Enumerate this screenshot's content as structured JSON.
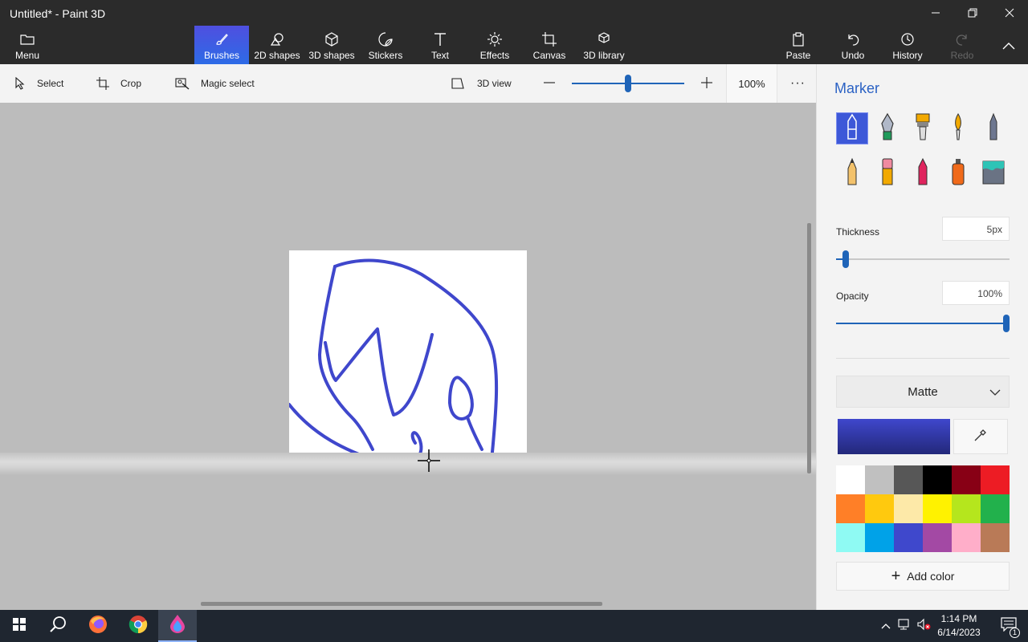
{
  "window": {
    "title": "Untitled* - Paint 3D",
    "minimize_icon": "minimize-icon",
    "restore_icon": "restore-icon",
    "close_icon": "close-icon"
  },
  "ribbon": {
    "menu_label": "Menu",
    "tabs": [
      {
        "label": "Brushes",
        "icon": "brush-icon",
        "active": true
      },
      {
        "label": "2D shapes",
        "icon": "2d-shapes-icon"
      },
      {
        "label": "3D shapes",
        "icon": "3d-shapes-icon"
      },
      {
        "label": "Stickers",
        "icon": "stickers-icon"
      },
      {
        "label": "Text",
        "icon": "text-icon"
      },
      {
        "label": "Effects",
        "icon": "effects-icon"
      },
      {
        "label": "Canvas",
        "icon": "canvas-icon"
      },
      {
        "label": "3D library",
        "icon": "3d-library-icon"
      }
    ],
    "actions": [
      {
        "label": "Paste",
        "icon": "paste-icon"
      },
      {
        "label": "Undo",
        "icon": "undo-icon"
      },
      {
        "label": "History",
        "icon": "history-icon"
      },
      {
        "label": "Redo",
        "icon": "redo-icon",
        "disabled": true
      }
    ]
  },
  "toolbar": {
    "select_label": "Select",
    "crop_label": "Crop",
    "magic_select_label": "Magic select",
    "view_3d_label": "3D view",
    "zoom_value": "100%",
    "zoom_level": 0.5,
    "more_label": "···"
  },
  "panel": {
    "title": "Marker",
    "brushes": [
      "marker",
      "calligraphy-pen",
      "oil-brush",
      "watercolor",
      "pixel-pen",
      "pencil",
      "eraser",
      "crayon",
      "spray-can",
      "fill"
    ],
    "thickness_label": "Thickness",
    "thickness_value": "5px",
    "thickness_level": 0.04,
    "opacity_label": "Opacity",
    "opacity_value": "100%",
    "opacity_level": 1.0,
    "finish": "Matte",
    "current_color": "#3f47cc",
    "palette": [
      "#ffffff",
      "#c0c0c0",
      "#575757",
      "#000000",
      "#880015",
      "#ed1c24",
      "#ff7f27",
      "#ffc90e",
      "#fde9a8",
      "#fff200",
      "#b5e61d",
      "#22b14c",
      "#8ffaf3",
      "#00a2e8",
      "#3f48cc",
      "#a349a4",
      "#ffaec9",
      "#b97a57"
    ],
    "add_color_label": "Add color"
  },
  "taskbar": {
    "time": "1:14 PM",
    "date": "6/14/2023",
    "notification_count": "1"
  }
}
